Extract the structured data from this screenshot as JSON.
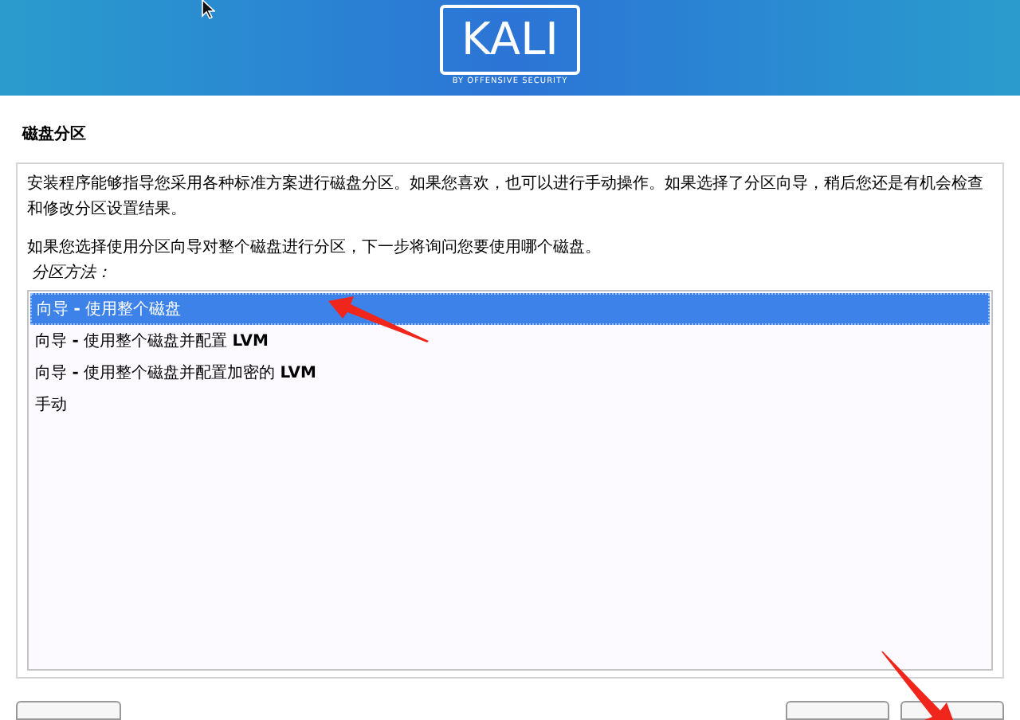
{
  "banner": {
    "logo": "KALI",
    "tagline": "BY OFFENSIVE SECURITY"
  },
  "title": "磁盘分区",
  "paragraphs": [
    "安装程序能够指导您采用各种标准方案进行磁盘分区。如果您喜欢，也可以进行手动操作。如果选择了分区向导，稍后您还是有机会检查和修改分区设置结果。",
    "如果您选择使用分区向导对整个磁盘进行分区，下一步将询问您要使用哪个磁盘。"
  ],
  "list_label": "分区方法：",
  "options": [
    {
      "label": "向导 **-** 使用整个磁盘",
      "selected": true
    },
    {
      "label": "向导 **-** 使用整个磁盘并配置 **LVM**",
      "selected": false
    },
    {
      "label": "向导 **-** 使用整个磁盘并配置加密的 **LVM**",
      "selected": false
    },
    {
      "label": "手动",
      "selected": false
    }
  ]
}
